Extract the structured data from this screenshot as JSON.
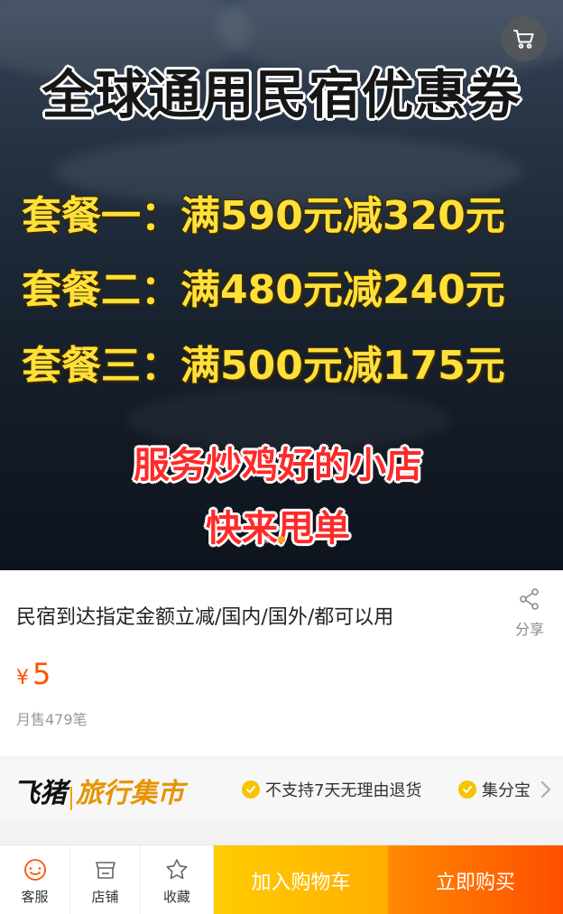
{
  "banner": {
    "title": "全球通用民宿优惠券",
    "deals": [
      "套餐一：满590元减320元",
      "套餐二：满480元减240元",
      "套餐三：满500元减175元"
    ],
    "promo_lines": [
      "服务炒鸡好的小店",
      "快来甩单"
    ],
    "carousel": {
      "count": 2,
      "active_index": 1,
      "active_color": "#f5a623"
    },
    "cart_icon": "shopping-cart-icon"
  },
  "product": {
    "title": "民宿到达指定金额立减/国内/国外/都可以用",
    "share_label": "分享",
    "share_icon": "share-icon",
    "price_symbol": "¥",
    "price": "5",
    "price_color": "#ff5000",
    "sales": "月售479笔"
  },
  "market": {
    "brand_main": "飞猪",
    "brand_sub": "旅行集市",
    "tags": [
      "不支持7天无理由退货",
      "集分宝"
    ],
    "tag_icon": "check-icon",
    "more_icon": "chevron-right-icon"
  },
  "bottom_bar": {
    "items": [
      {
        "label": "客服",
        "icon": "customer-service-icon"
      },
      {
        "label": "店铺",
        "icon": "shop-icon"
      },
      {
        "label": "收藏",
        "icon": "star-icon"
      }
    ],
    "add_to_cart": "加入购物车",
    "buy_now": "立即购买",
    "accent_yellow": "#ffb400",
    "accent_orange": "#ff5000"
  }
}
